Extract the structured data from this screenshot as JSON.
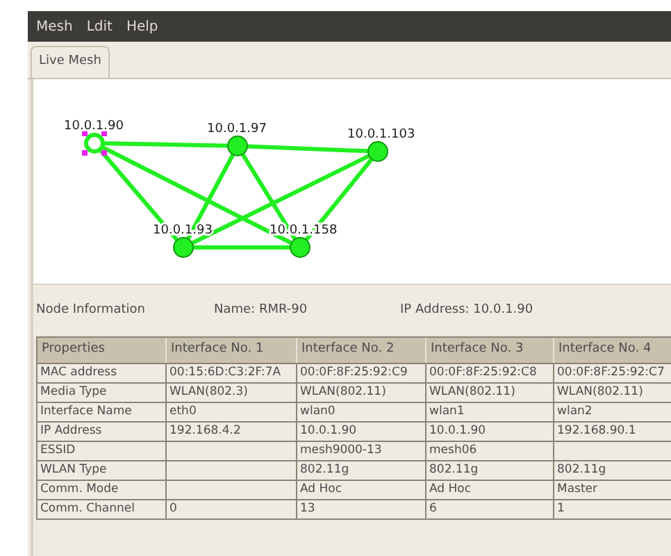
{
  "menu": [
    {
      "label": "Mesh"
    },
    {
      "label": "Ldit"
    },
    {
      "label": "Help"
    }
  ],
  "tabs": [
    {
      "label": "Live Mesh",
      "selected": true
    }
  ],
  "mesh": {
    "nodes": [
      {
        "label": "10.0.1.90",
        "selected": true
      },
      {
        "label": "10.0.1.97",
        "selected": false
      },
      {
        "label": "10.0.1.103",
        "selected": false
      },
      {
        "label": "10.0.1.93",
        "selected": false
      },
      {
        "label": "10.0.1.158",
        "selected": false
      }
    ]
  },
  "node_info": {
    "heading": "Node Information",
    "name": "Name: RMR-90",
    "ip": "IP Address: 10.0.1.90"
  },
  "table": {
    "columns": [
      "Properties",
      "Interface No. 1",
      "Interface No. 2",
      "Interface No. 3",
      "Interface No. 4"
    ],
    "rows": [
      [
        "MAC address",
        "00:15:6D:C3:2F:7A",
        "00:0F:8F:25:92:C9",
        "00:0F:8F:25:92:C8",
        "00:0F:8F:25:92:C7"
      ],
      [
        "Media Type",
        "WLAN(802.3)",
        "WLAN(802.11)",
        "WLAN(802.11)",
        "WLAN(802.11)"
      ],
      [
        "Interface Name",
        "eth0",
        "wlan0",
        "wlan1",
        "wlan2"
      ],
      [
        "IP Address",
        "192.168.4.2",
        "10.0.1.90",
        "10.0.1.90",
        "192.168.90.1"
      ],
      [
        "ESSID",
        "",
        "mesh9000-13",
        "mesh06",
        ""
      ],
      [
        "WLAN Type",
        "",
        "802.11g",
        "802.11g",
        "802.11g"
      ],
      [
        "Comm. Mode",
        "",
        "Ad Hoc",
        "Ad Hoc",
        "Master"
      ],
      [
        "Comm. Channel",
        "0",
        "13",
        "6",
        "1"
      ]
    ]
  }
}
